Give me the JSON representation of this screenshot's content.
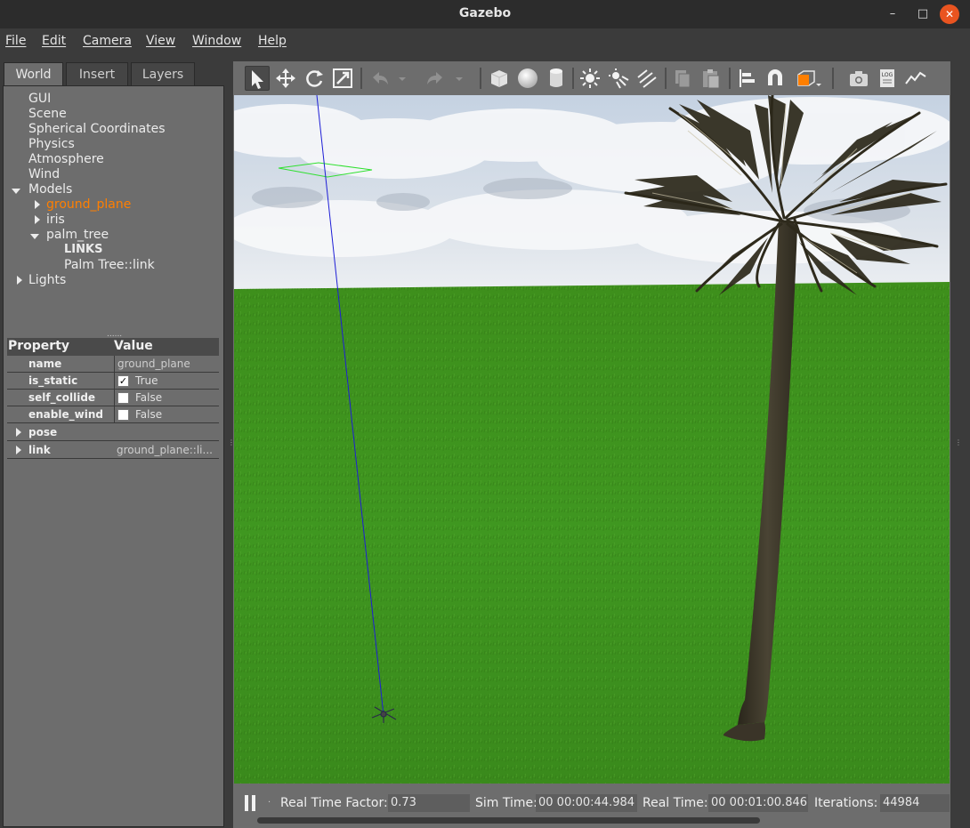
{
  "window": {
    "title": "Gazebo",
    "minimize": "–",
    "maximize": "□",
    "close": "✕"
  },
  "menu": [
    {
      "label": "File"
    },
    {
      "label": "Edit"
    },
    {
      "label": "Camera"
    },
    {
      "label": "View"
    },
    {
      "label": "Window"
    },
    {
      "label": "Help"
    }
  ],
  "left_tabs": [
    {
      "label": "World"
    },
    {
      "label": "Insert"
    },
    {
      "label": "Layers"
    }
  ],
  "tree": {
    "gui": "GUI",
    "scene": "Scene",
    "spherical": "Spherical Coordinates",
    "physics": "Physics",
    "atmosphere": "Atmosphere",
    "wind": "Wind",
    "models": "Models",
    "ground_plane": "ground_plane",
    "iris": "iris",
    "palm_tree": "palm_tree",
    "links": "LINKS",
    "palm_link": "Palm Tree::link",
    "lights": "Lights"
  },
  "splitter": "......",
  "properties": {
    "header_property": "Property",
    "header_value": "Value",
    "rows": [
      {
        "key": "name",
        "value": "ground_plane"
      },
      {
        "key": "is_static",
        "value": "True",
        "checked": "✓"
      },
      {
        "key": "self_collide",
        "value": "False"
      },
      {
        "key": "enable_wind",
        "value": "False"
      }
    ],
    "pose": "pose",
    "link_key": "link",
    "link_value": "ground_plane::li..."
  },
  "toolbar_icons": [
    "select-arrow-icon",
    "translate-icon",
    "rotate-icon",
    "scale-icon",
    "undo-icon",
    "redo-icon",
    "box-icon",
    "sphere-icon",
    "cylinder-icon",
    "point-light-icon",
    "spot-light-icon",
    "directional-light-icon",
    "copy-icon",
    "paste-icon",
    "align-icon",
    "snap-icon",
    "view-angle-icon",
    "screenshot-icon",
    "log-icon",
    "plot-icon"
  ],
  "status": {
    "rtf_label": "Real Time Factor:",
    "rtf_value": "0.73",
    "sim_label": "Sim Time:",
    "sim_value": "00 00:00:44.984",
    "real_label": "Real Time:",
    "real_value": "00 00:01:00.846",
    "iter_label": "Iterations:",
    "iter_value": "44984"
  },
  "colors": {
    "selected_model": "#ff7f00",
    "accent_close": "#e95420",
    "ground": "#3f8f1f",
    "sky": "#cfd8e4"
  }
}
